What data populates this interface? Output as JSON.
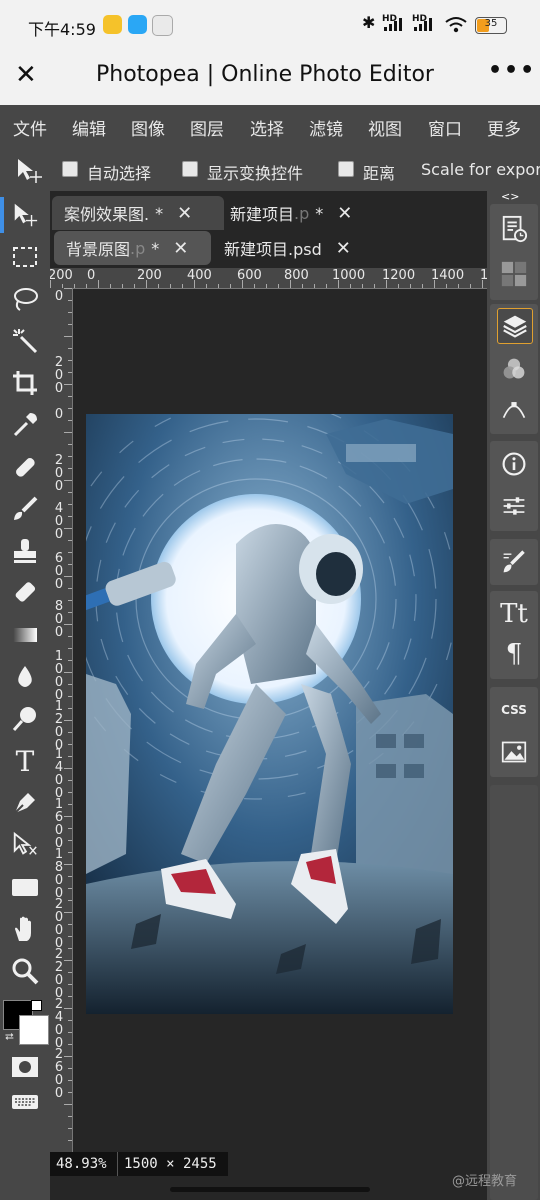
{
  "status_bar": {
    "time": "下午4:59",
    "signal1": "HD",
    "signal2": "HD",
    "battery": "35"
  },
  "browser": {
    "title": "Photopea | Online Photo Editor",
    "close_icon": "close-icon",
    "more_icon": "more-icon"
  },
  "menu": [
    "文件",
    "编辑",
    "图像",
    "图层",
    "选择",
    "滤镜",
    "视图",
    "窗口",
    "更多"
  ],
  "options": {
    "auto_select": "自动选择",
    "show_transform": "显示变换控件",
    "distance": "距离",
    "scale_for_export": "Scale for expor"
  },
  "tabs": {
    "row1": [
      {
        "label": "案例效果图.",
        "suffix": "*"
      },
      {
        "label": "新建项目",
        "suffix": "*"
      }
    ],
    "row2": [
      {
        "label": "背景原图",
        "suffix": "*"
      },
      {
        "label": "新建项目.psd",
        "suffix": ""
      }
    ],
    "faded_ext": ".p",
    "panel_toggle": "<>"
  },
  "ruler": {
    "h_ticks": [
      "200",
      "0",
      "200",
      "400",
      "600",
      "800",
      "1000",
      "1200",
      "1400",
      "1"
    ],
    "v_ticks": [
      "0",
      "200",
      "0",
      "200",
      "400",
      "600",
      "800",
      "1000",
      "1200",
      "1400",
      "1600",
      "1800",
      "2000",
      "2200",
      "2400",
      "2600"
    ]
  },
  "status": {
    "zoom": "48.93%",
    "size": "1500 × 2455"
  },
  "watermark": "@远程教育",
  "colors": {
    "ui_dark": "#474747",
    "workspace": "#262626",
    "accent_active": "#e0a030"
  }
}
